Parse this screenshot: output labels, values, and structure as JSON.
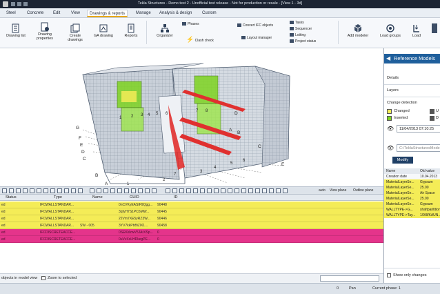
{
  "app": {
    "window_title": "Tekla Structures - Demo test 2 - Unofficial test release - Not for production or resale - [View 1 - 3d]"
  },
  "menu": {
    "tabs": [
      {
        "label": "Steel"
      },
      {
        "label": "Concrete"
      },
      {
        "label": "Edit"
      },
      {
        "label": "View"
      },
      {
        "label": "Drawings & reports"
      },
      {
        "label": "Manage"
      },
      {
        "label": "Analysis & design"
      },
      {
        "label": "Custom"
      }
    ],
    "active_index": 4
  },
  "ribbon": {
    "drawing_list": "Drawing list",
    "drawing_properties": "Drawing properties",
    "create_drawings": "Create drawings",
    "ga_drawing": "GA drawing",
    "reports": "Reports",
    "organizer": "Organizer",
    "phases": "Phases",
    "clash_check": "Clash check",
    "convert_ifc": "Convert IFC objects",
    "layout_manager": "Layout manager",
    "tasks": "Tasks",
    "sequencer": "Sequencer",
    "lotting": "Lotting",
    "project_status": "Project status",
    "add_modeler": "Add modeler",
    "load_groups": "Load groups",
    "load": "Load"
  },
  "viewport": {
    "grid_labels_left": [
      "G",
      "F",
      "E",
      "D",
      "C",
      "B",
      "A"
    ],
    "grid_labels_bottom": [
      "1",
      "2",
      "3",
      "4",
      "5",
      "6",
      "7"
    ],
    "grid_labels_inside": [
      "1",
      "2",
      "3",
      "4",
      "5",
      "6",
      "7",
      "8"
    ],
    "grid_labels_inside_right": [
      "A",
      "B",
      "C",
      "D",
      "E"
    ]
  },
  "view_toolbar": {
    "auto": "auto",
    "view_plane": "View plane",
    "outline_plane": "Outline plane"
  },
  "grid": {
    "columns": [
      "Status",
      "Type",
      "Name",
      "GUID",
      "ID"
    ],
    "rows": [
      {
        "status": "ed",
        "type": "IFCWALLSTANDAR...",
        "name": "",
        "guid": "0nCVKyEAStF9Qgg...",
        "id": "90448",
        "color": "yellow"
      },
      {
        "status": "ed",
        "type": "IFCWALLSTANDAR...",
        "name": "",
        "guid": "3qfyH7S1PC6MW...",
        "id": "90445",
        "color": "yellow"
      },
      {
        "status": "ed",
        "type": "IFCWALLSTANDAR...",
        "name": "",
        "guid": "22Vm7XE5yRZ3W...",
        "id": "90446",
        "color": "yellow"
      },
      {
        "status": "ed",
        "type": "IFCWALLSTANDAR...",
        "name": "SW - 005",
        "guid": "3YV7kkPbBiZlX1...",
        "id": "90458",
        "color": "yellow"
      },
      {
        "status": "ed",
        "type": "IFCDISCRETEACCE...",
        "name": "",
        "guid": "0SEKklzwV5JArXSp...",
        "id": "0",
        "color": "pink"
      },
      {
        "status": "ed",
        "type": "IFCDISCRETEACCE...",
        "name": "",
        "guid": "0uVvXxLHDkegPE...",
        "id": "0",
        "color": "pink"
      }
    ]
  },
  "grid_footer": {
    "objects_in_view": "objects in model view",
    "zoom_to_selected": "Zoom to selected"
  },
  "status_bar": {
    "left": "0",
    "pan": "Pan",
    "current_phase": "Current phase: 1"
  },
  "reference_panel": {
    "title": "Reference Models",
    "details": "Details",
    "layers": "Layers",
    "change_detection": "Change detection",
    "legend": [
      {
        "label": "Changed",
        "color": "#f4ec57"
      },
      {
        "label": "Inserted",
        "color": "#7ed321"
      },
      {
        "label": "U",
        "color": "#555555"
      },
      {
        "label": "D",
        "color": "#555555"
      }
    ],
    "timestamp": "11/04/2013 07:10:25",
    "path": "C:\\TeklaStructuresModels\\",
    "modify": "Modify",
    "table_header": [
      "Name",
      "Old value"
    ],
    "table_rows": [
      {
        "name": "Creation date",
        "value": "10.04.2013",
        "color": "white"
      },
      {
        "name": "MaterialLayerSe...",
        "value": "Gypsum",
        "color": "yellow"
      },
      {
        "name": "MaterialLayerSe...",
        "value": "25.00",
        "color": "yellow"
      },
      {
        "name": "MaterialLayerSe...",
        "value": "Air Space",
        "color": "yellow"
      },
      {
        "name": "MaterialLayerSe...",
        "value": "25.00",
        "color": "yellow"
      },
      {
        "name": "MaterialLayerSe...",
        "value": "Gypsum",
        "color": "yellow"
      },
      {
        "name": "WALLTYPE->G...",
        "value": "shaftparitition",
        "color": "yellow"
      },
      {
        "name": "WALLTYPE->Tay...",
        "value": "1/9/8/KAUN...",
        "color": "yellow"
      }
    ],
    "show_only_changes": "Show only changes"
  }
}
